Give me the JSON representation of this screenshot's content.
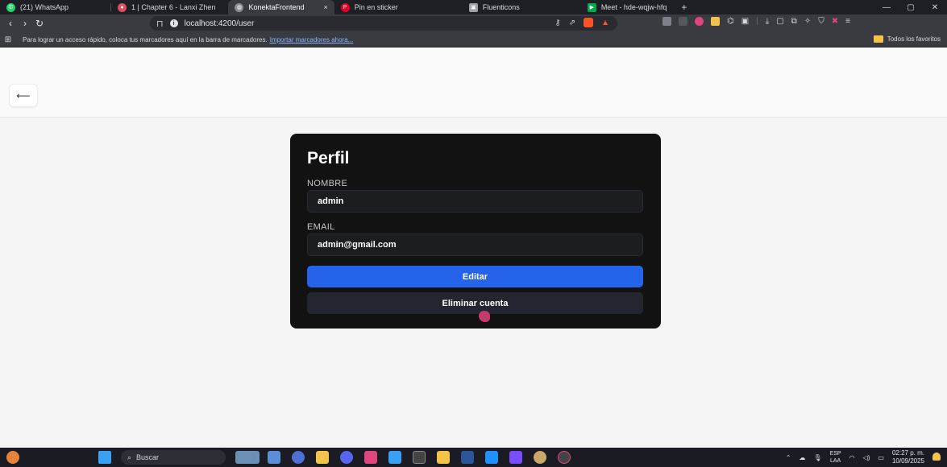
{
  "browser": {
    "tabs": [
      {
        "label": "(21) WhatsApp",
        "color": "#25d366"
      },
      {
        "label": "1 | Chapter 6 - Lanxi Zhen",
        "color": "#e44d5d"
      },
      {
        "label": "KonektaFrontend",
        "color": "#8a8c91",
        "active": true
      },
      {
        "label": "Pin en sticker",
        "color": "#e60023"
      },
      {
        "label": "Fluenticons",
        "color": "#9ca0a8"
      },
      {
        "label": "Meet - hde-wqjw-hfq",
        "color": "#00ac47"
      }
    ],
    "tab_close": "×",
    "new_tab": "+",
    "url": "localhost:4200/user",
    "bookmarks_message": "Para lograr un acceso rápido, coloca tus marcadores aquí en la barra de marcadores.",
    "bookmarks_link": "Importar marcadores ahora...",
    "favorites_label": "Todos los favoritos"
  },
  "page": {
    "back_label": "⟵",
    "profile": {
      "title": "Perfil",
      "name_label": "NOMBRE",
      "name_value": "admin",
      "email_label": "EMAIL",
      "email_value": "admin@gmail.com",
      "edit_label": "Editar",
      "delete_label": "Eliminar cuenta"
    }
  },
  "taskbar": {
    "search_label": "Buscar",
    "language": "ESP",
    "language_sub": "LAA",
    "time": "02:27 p. m.",
    "date": "10/09/2025"
  },
  "colors": {
    "primary": "#2563eb",
    "card": "#121212",
    "secondary": "#23262e"
  }
}
